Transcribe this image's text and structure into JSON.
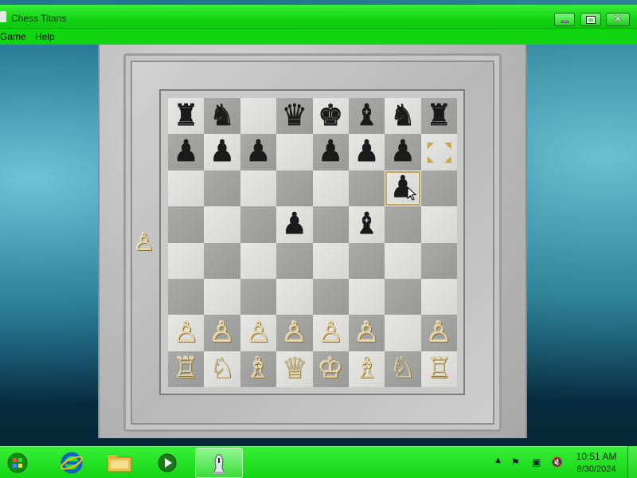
{
  "window": {
    "title": "Chess Titans",
    "controls": {
      "minimize_icon": "minimize-icon",
      "maximize_icon": "maximize-icon",
      "close_glyph": "✕"
    }
  },
  "menubar": {
    "items": [
      "Game",
      "Help"
    ]
  },
  "board": {
    "ranks": [
      [
        "♜",
        "♞",
        "",
        "♛",
        "♚",
        "♝",
        "♞",
        "♜"
      ],
      [
        "♟",
        "♟",
        "♟",
        "",
        "♟",
        "♟",
        "♟",
        ""
      ],
      [
        "",
        "",
        "",
        "",
        "",
        "",
        "♟",
        ""
      ],
      [
        "",
        "",
        "",
        "♟",
        "",
        "♝",
        "",
        ""
      ],
      [
        "",
        "",
        "",
        "",
        "",
        "",
        "",
        ""
      ],
      [
        "",
        "",
        "",
        "",
        "",
        "",
        "",
        ""
      ],
      [
        "♙",
        "♙",
        "♙",
        "♙",
        "♙",
        "♙",
        "",
        "♙"
      ],
      [
        "♖",
        "♘",
        "♗",
        "♕",
        "♔",
        "♗",
        "♘",
        "♖"
      ]
    ],
    "colors": [
      [
        "b",
        "b",
        "",
        "b",
        "b",
        "b",
        "b",
        "b"
      ],
      [
        "b",
        "b",
        "b",
        "",
        "b",
        "b",
        "b",
        ""
      ],
      [
        "",
        "",
        "",
        "",
        "",
        "",
        "b",
        ""
      ],
      [
        "",
        "",
        "",
        "b",
        "",
        "b",
        "",
        ""
      ],
      [
        "",
        "",
        "",
        "",
        "",
        "",
        "",
        ""
      ],
      [
        "",
        "",
        "",
        "",
        "",
        "",
        "",
        ""
      ],
      [
        "w",
        "w",
        "w",
        "w",
        "w",
        "w",
        "",
        "w"
      ],
      [
        "w",
        "w",
        "w",
        "w",
        "w",
        "w",
        "w",
        "w"
      ]
    ],
    "selected_square": [
      2,
      6
    ],
    "move_hint_square": [
      1,
      7
    ],
    "light_color": "#e0e0de",
    "dark_color": "#a3a3a1"
  },
  "captured": {
    "white_side": [
      "♙"
    ]
  },
  "taskbar": {
    "icons": [
      "windows-logo-icon",
      "internet-explorer-icon",
      "windows-explorer-icon",
      "media-player-icon",
      "chess-titans-icon"
    ],
    "tray": {
      "up_arrow": "▲",
      "flag": "⚑",
      "network": "▣",
      "volume": "🔇"
    },
    "clock": {
      "time": "10:51 AM",
      "date": "8/30/2024"
    }
  },
  "colors": {
    "chrome_green": "#14d414",
    "white_piece": "#e9d7a8",
    "black_piece": "#1b1b1b"
  }
}
